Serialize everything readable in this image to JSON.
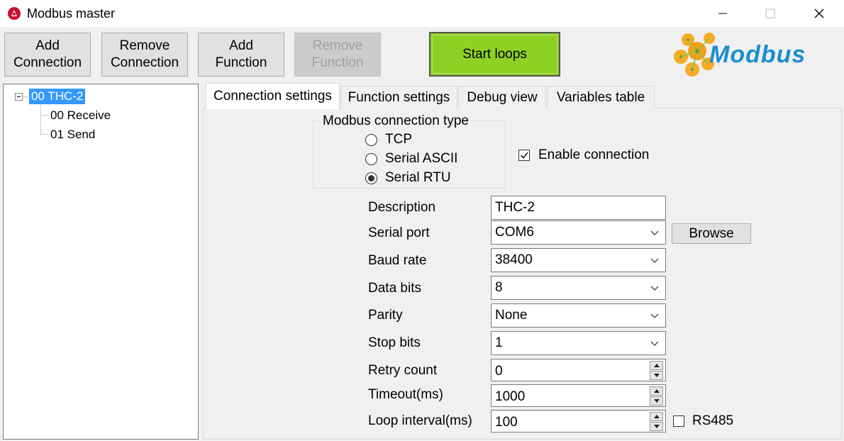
{
  "window": {
    "title": "Modbus master"
  },
  "toolbar": {
    "add_connection": [
      "Add",
      "Connection"
    ],
    "remove_connection": [
      "Remove",
      "Connection"
    ],
    "add_function": [
      "Add",
      "Function"
    ],
    "remove_function": [
      "Remove",
      "Function"
    ],
    "start_loops": "Start loops",
    "start_color": "#8fd024"
  },
  "logo": {
    "text": "Modbus",
    "color": "#1a8fd0"
  },
  "tree": {
    "root": "00 THC-2",
    "children": [
      "00 Receive",
      "01 Send"
    ],
    "selection_color": "#3399ff"
  },
  "tabs": [
    "Connection settings",
    "Function settings",
    "Debug view",
    "Variables table"
  ],
  "connection_type": {
    "title": "Modbus connection type",
    "options": [
      "TCP",
      "Serial ASCII",
      "Serial RTU"
    ],
    "selected": "Serial RTU"
  },
  "enable_connection": {
    "label": "Enable connection",
    "checked": true
  },
  "fields": {
    "description": {
      "label": "Description",
      "value": "THC-2"
    },
    "serial_port": {
      "label": "Serial port",
      "value": "COM6"
    },
    "baud_rate": {
      "label": "Baud rate",
      "value": "38400"
    },
    "data_bits": {
      "label": "Data bits",
      "value": "8"
    },
    "parity": {
      "label": "Parity",
      "value": "None"
    },
    "stop_bits": {
      "label": "Stop bits",
      "value": "1"
    },
    "retry_count": {
      "label": "Retry count",
      "value": "0"
    },
    "timeout": {
      "label": "Timeout(ms)",
      "value": "1000"
    },
    "loop_interval": {
      "label": "Loop interval(ms)",
      "value": "100"
    }
  },
  "browse_label": "Browse",
  "rs485": {
    "label": "RS485",
    "checked": false
  }
}
